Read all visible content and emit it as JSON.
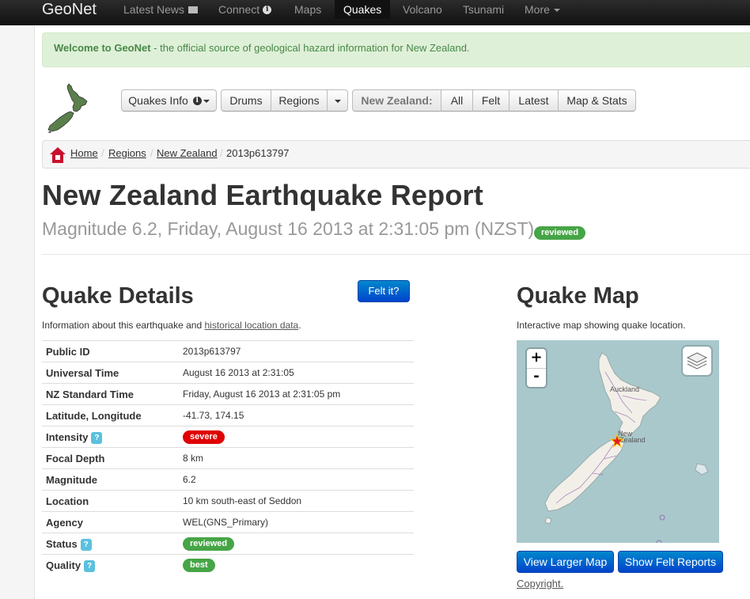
{
  "navbar": {
    "brand": "GeoNet",
    "items": [
      {
        "label": "Latest News"
      },
      {
        "label": "Connect"
      },
      {
        "label": "Maps"
      },
      {
        "label": "Quakes"
      },
      {
        "label": "Volcano"
      },
      {
        "label": "Tsunami"
      },
      {
        "label": "More"
      }
    ],
    "active": "Quakes"
  },
  "alert": {
    "strong": "Welcome to GeoNet",
    "text": " - the official source of geological hazard information for New Zealand."
  },
  "toolbar": {
    "quakes_info": "Quakes Info",
    "drums": "Drums",
    "regions": "Regions",
    "nz_label": "New Zealand:",
    "all": "All",
    "felt": "Felt",
    "latest": "Latest",
    "map_stats": "Map & Stats"
  },
  "breadcrumb": {
    "home": "Home",
    "regions": "Regions",
    "new_zealand": "New Zealand",
    "current": "2013p613797",
    "separator": "/"
  },
  "title": "New Zealand Earthquake Report",
  "subtitle": "Magnitude 6.2, Friday, August 16 2013 at 2:31:05 pm (NZST)",
  "subtitle_badge": "reviewed",
  "details": {
    "heading": "Quake Details",
    "felt_button": "Felt it?",
    "description_prefix": "Information about this earthquake and ",
    "description_link": "historical location data",
    "description_suffix": ".",
    "rows": [
      {
        "key": "Public ID",
        "value": "2013p613797"
      },
      {
        "key": "Universal Time",
        "value": "August 16 2013 at 2:31:05"
      },
      {
        "key": "NZ Standard Time",
        "value": "Friday, August 16 2013 at 2:31:05 pm"
      },
      {
        "key": "Latitude, Longitude",
        "value": "-41.73, 174.15"
      },
      {
        "key": "Intensity",
        "value": "severe",
        "help": "?"
      },
      {
        "key": "Focal Depth",
        "value": "8 km"
      },
      {
        "key": "Magnitude",
        "value": "6.2"
      },
      {
        "key": "Location",
        "value": "10 km south-east of Seddon"
      },
      {
        "key": "Agency",
        "value": "WEL(GNS_Primary)"
      },
      {
        "key": "Status",
        "value": "reviewed",
        "help": "?"
      },
      {
        "key": "Quality",
        "value": "best",
        "help": "?"
      }
    ]
  },
  "map": {
    "heading": "Quake Map",
    "description": "Interactive map showing quake location.",
    "zoom_in": "+",
    "zoom_out": "-",
    "label_auckland": "Auckland",
    "label_nz_line1": "New",
    "label_nz_line2": "Zealand",
    "view_larger": "View Larger Map",
    "show_felt": "Show Felt Reports",
    "copyright": "Copyright."
  },
  "colors": {
    "brand_blue": "#0055cc",
    "badge_green": "#46a546",
    "badge_red": "#e00000",
    "alert_green": "#468847",
    "help_blue": "#5bc0de"
  }
}
